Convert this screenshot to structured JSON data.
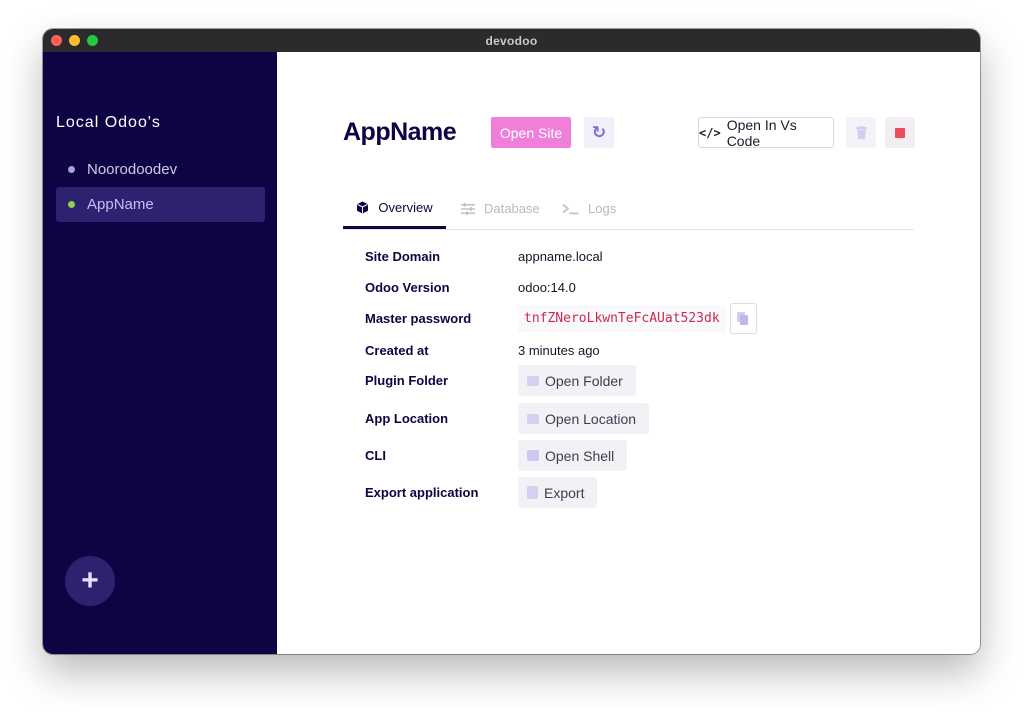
{
  "window": {
    "title": "devodoo"
  },
  "sidebar": {
    "title": "Local Odoo's",
    "items": [
      {
        "label": "Noorodoodev",
        "dot_color": "#a9a0d6",
        "active": false
      },
      {
        "label": "AppName",
        "dot_color": "#8fd14f",
        "active": true
      }
    ],
    "add_label": "+"
  },
  "header": {
    "app_name": "AppName",
    "open_site_label": "Open Site",
    "refresh_icon": "↻",
    "open_vscode_label": "Open In Vs Code",
    "code_icon": "</>"
  },
  "tabs": [
    {
      "label": "Overview",
      "icon": "cube-icon",
      "active": true
    },
    {
      "label": "Database",
      "icon": "sliders-icon",
      "active": false
    },
    {
      "label": "Logs",
      "icon": "terminal-icon",
      "active": false
    }
  ],
  "details": {
    "site_domain": {
      "label": "Site Domain",
      "value": "appname.local"
    },
    "odoo_version": {
      "label": "Odoo Version",
      "value": "odoo:14.0"
    },
    "master_password": {
      "label": "Master password",
      "value": "tnfZNeroLkwnTeFcAUat523dk"
    },
    "created_at": {
      "label": "Created at",
      "value": "3 minutes ago"
    },
    "plugin_folder": {
      "label": "Plugin Folder",
      "button": "Open Folder"
    },
    "app_location": {
      "label": "App Location",
      "button": "Open Location"
    },
    "cli": {
      "label": "CLI",
      "button": "Open Shell"
    },
    "export": {
      "label": "Export application",
      "button": "Export"
    }
  },
  "colors": {
    "sidebar_bg": "#0f0443",
    "accent_pink": "#f07fd9",
    "accent_purple": "#7c6ed6",
    "danger": "#ec4c5c"
  }
}
